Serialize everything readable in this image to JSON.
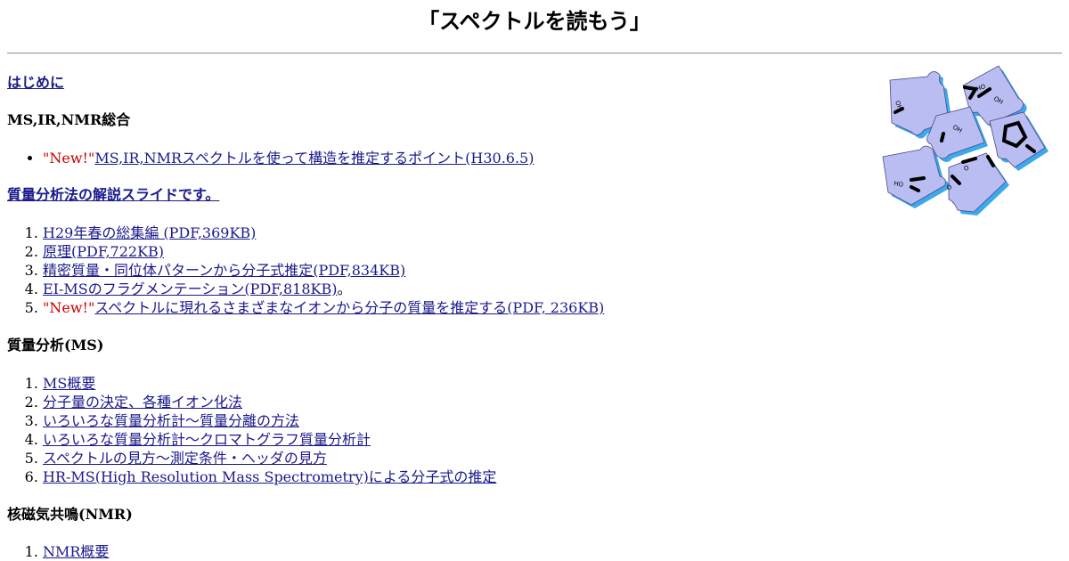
{
  "header": {
    "title": "「スペクトルを読もう」"
  },
  "sections": {
    "intro": {
      "label": "はじめに"
    },
    "overview": {
      "heading": "MS,IR,NMR総合",
      "items": [
        {
          "badge": "\"New!\"",
          "label": "MS,IR,NMRスペクトルを使って構造を推定するポイント(H30.6.5)"
        }
      ]
    },
    "slides": {
      "heading": "質量分析法の解説スライドです。",
      "items": [
        {
          "label": "H29年春の総集編 (PDF,369KB)",
          "suffix": ""
        },
        {
          "label": "原理(PDF,722KB)",
          "suffix": ""
        },
        {
          "label": "精密質量・同位体パターンから分子式推定(PDF,834KB)",
          "suffix": ""
        },
        {
          "label": "EI-MSのフラグメンテーション(PDF,818KB)",
          "suffix": "。"
        },
        {
          "badge": "\"New!\"",
          "label": "スペクトルに現れるさまざまなイオンから分子の質量を推定する(PDF, 236KB)",
          "suffix": ""
        }
      ]
    },
    "ms": {
      "heading": "質量分析(MS)",
      "items": [
        {
          "label": "MS概要"
        },
        {
          "label": "分子量の決定、各種イオン化法"
        },
        {
          "label": "いろいろな質量分析計～質量分離の方法"
        },
        {
          "label": "いろいろな質量分析計～クロマトグラフ質量分析計"
        },
        {
          "label": "スペクトルの見方～測定条件・ヘッダの見方"
        },
        {
          "label": "HR-MS(High Resolution Mass Spectrometry)による分子式の推定"
        }
      ]
    },
    "nmr": {
      "heading": "核磁気共鳴(NMR)",
      "items": [
        {
          "label": "NMR概要"
        }
      ]
    }
  },
  "logo": {
    "icon": "puzzle-molecule-logo",
    "colors": {
      "piece": "#b9bdf2",
      "shadow": "#3aa9ee",
      "ink": "#000000"
    },
    "piece_labels": [
      "OH",
      "OH",
      "OH",
      "HO",
      "O",
      "OH",
      "O"
    ]
  }
}
